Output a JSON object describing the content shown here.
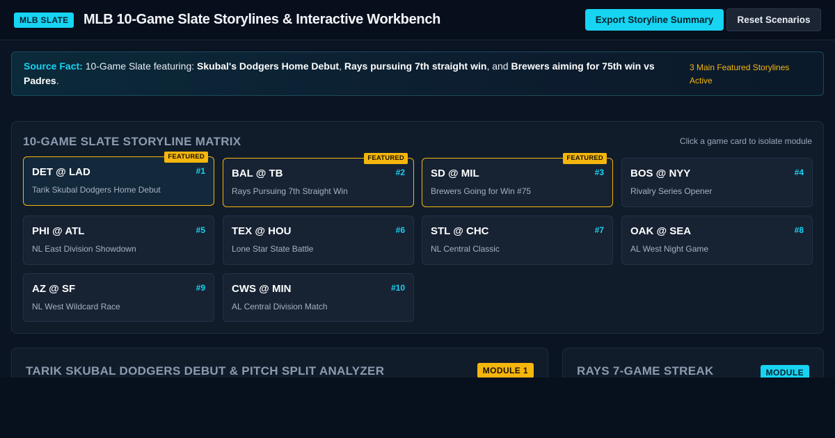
{
  "header": {
    "badge": "MLB SLATE",
    "title": "MLB 10-Game Slate Storylines & Interactive Workbench",
    "export_label": "Export Storyline Summary",
    "reset_label": "Reset Scenarios"
  },
  "fact": {
    "label": "Source Fact:",
    "intro": " 10-Game Slate featuring: ",
    "item1": "Skubal's Dodgers Home Debut",
    "sep1": ", ",
    "item2": "Rays pursuing 7th straight win",
    "sep2": ", and ",
    "item3": "Brewers aiming for 75th win vs Padres",
    "end": ".",
    "status": "3 Main Featured Storylines Active"
  },
  "matrix": {
    "title": "10-GAME SLATE STORYLINE MATRIX",
    "hint": "Click a game card to isolate module",
    "featured_label": "FEATURED",
    "games": [
      {
        "matchup": "DET @ LAD",
        "rank": "#1",
        "desc": "Tarik Skubal Dodgers Home Debut",
        "featured": true,
        "selected": true
      },
      {
        "matchup": "BAL @ TB",
        "rank": "#2",
        "desc": "Rays Pursuing 7th Straight Win",
        "featured": true,
        "selected": false
      },
      {
        "matchup": "SD @ MIL",
        "rank": "#3",
        "desc": "Brewers Going for Win #75",
        "featured": true,
        "selected": false
      },
      {
        "matchup": "BOS @ NYY",
        "rank": "#4",
        "desc": "Rivalry Series Opener",
        "featured": false,
        "selected": false
      },
      {
        "matchup": "PHI @ ATL",
        "rank": "#5",
        "desc": "NL East Division Showdown",
        "featured": false,
        "selected": false
      },
      {
        "matchup": "TEX @ HOU",
        "rank": "#6",
        "desc": "Lone Star State Battle",
        "featured": false,
        "selected": false
      },
      {
        "matchup": "STL @ CHC",
        "rank": "#7",
        "desc": "NL Central Classic",
        "featured": false,
        "selected": false
      },
      {
        "matchup": "OAK @ SEA",
        "rank": "#8",
        "desc": "AL West Night Game",
        "featured": false,
        "selected": false
      },
      {
        "matchup": "AZ @ SF",
        "rank": "#9",
        "desc": "NL West Wildcard Race",
        "featured": false,
        "selected": false
      },
      {
        "matchup": "CWS @ MIN",
        "rank": "#10",
        "desc": "AL Central Division Match",
        "featured": false,
        "selected": false
      }
    ]
  },
  "modules": [
    {
      "title": "TARIK SKUBAL DODGERS DEBUT & PITCH SPLIT ANALYZER",
      "badge": "MODULE 1"
    },
    {
      "title": "RAYS 7-GAME STREAK",
      "badge": "MODULE"
    }
  ],
  "colors": {
    "accent": "#17d4f2",
    "featured": "#f5b60d",
    "background": "#07101d"
  }
}
